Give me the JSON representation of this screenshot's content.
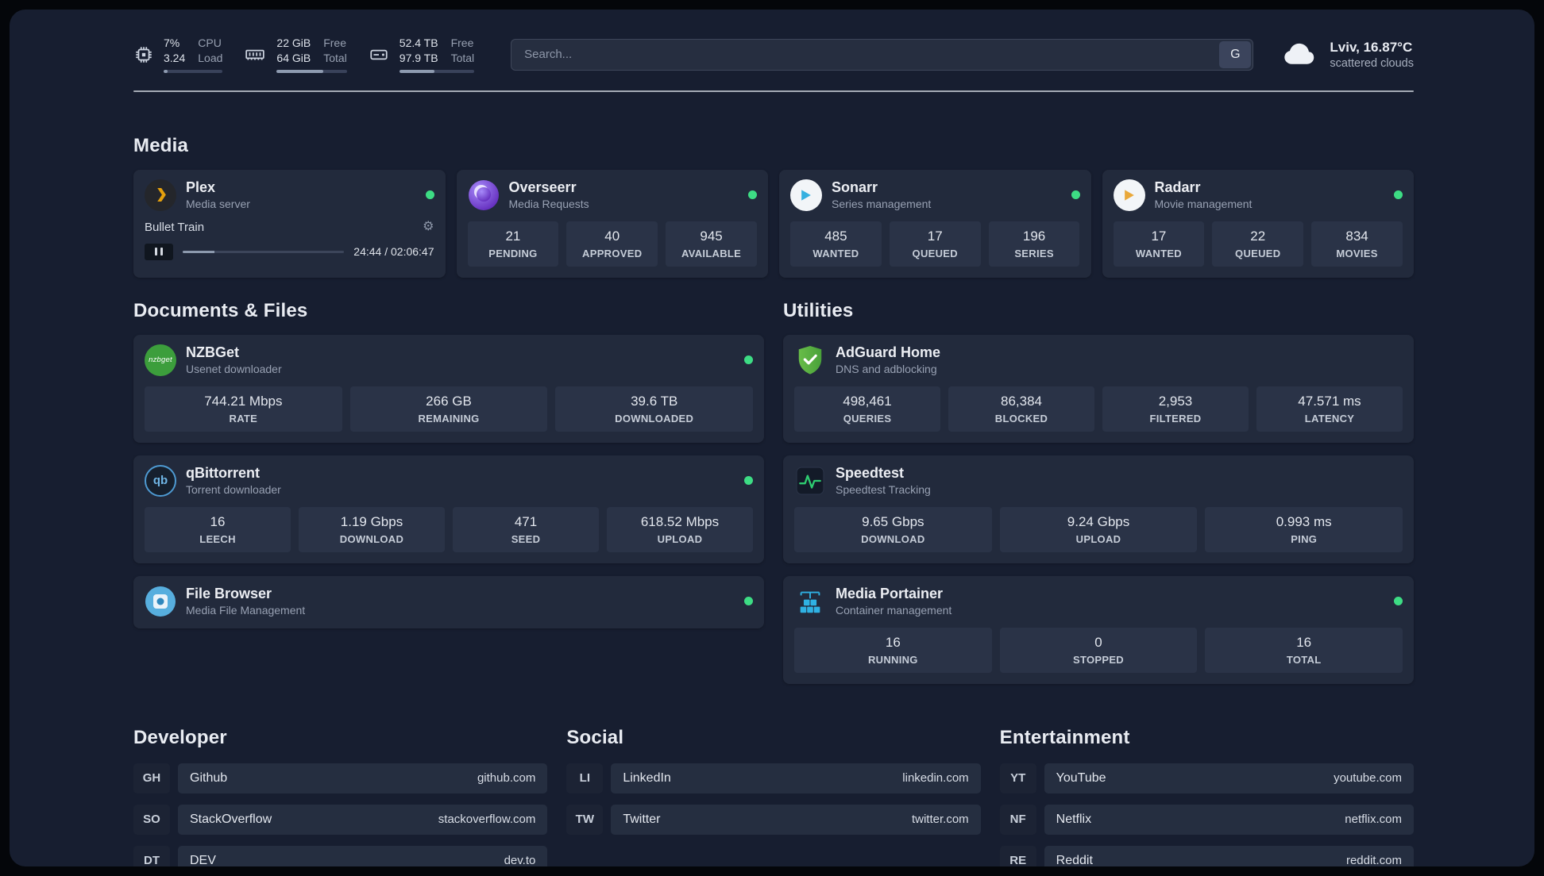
{
  "topbar": {
    "cpu": {
      "percent": "7%",
      "value": "3.24",
      "label1": "CPU",
      "label2": "Load",
      "bar_percent": 7
    },
    "memory": {
      "free": "22 GiB",
      "total": "64 GiB",
      "label1": "Free",
      "label2": "Total",
      "bar_percent": 66
    },
    "disk": {
      "free": "52.4 TB",
      "total": "97.9 TB",
      "label1": "Free",
      "label2": "Total",
      "bar_percent": 47
    },
    "search": {
      "placeholder": "Search...",
      "engine": "G"
    },
    "weather": {
      "location": "Lviv, 16.87°C",
      "condition": "scattered clouds"
    }
  },
  "media": {
    "title": "Media",
    "plex": {
      "name": "Plex",
      "desc": "Media server",
      "now_playing": "Bullet Train",
      "time": "24:44 / 02:06:47",
      "progress_percent": 19.5
    },
    "overseerr": {
      "name": "Overseerr",
      "desc": "Media Requests",
      "stats": [
        {
          "value": "21",
          "label": "PENDING"
        },
        {
          "value": "40",
          "label": "APPROVED"
        },
        {
          "value": "945",
          "label": "AVAILABLE"
        }
      ]
    },
    "sonarr": {
      "name": "Sonarr",
      "desc": "Series management",
      "stats": [
        {
          "value": "485",
          "label": "WANTED"
        },
        {
          "value": "17",
          "label": "QUEUED"
        },
        {
          "value": "196",
          "label": "SERIES"
        }
      ]
    },
    "radarr": {
      "name": "Radarr",
      "desc": "Movie management",
      "stats": [
        {
          "value": "17",
          "label": "WANTED"
        },
        {
          "value": "22",
          "label": "QUEUED"
        },
        {
          "value": "834",
          "label": "MOVIES"
        }
      ]
    }
  },
  "documents": {
    "title": "Documents & Files",
    "nzbget": {
      "name": "NZBGet",
      "desc": "Usenet downloader",
      "icon_text": "nzbget",
      "stats": [
        {
          "value": "744.21 Mbps",
          "label": "RATE"
        },
        {
          "value": "266 GB",
          "label": "REMAINING"
        },
        {
          "value": "39.6 TB",
          "label": "DOWNLOADED"
        }
      ]
    },
    "qbittorrent": {
      "name": "qBittorrent",
      "desc": "Torrent downloader",
      "icon_text": "qb",
      "stats": [
        {
          "value": "16",
          "label": "LEECH"
        },
        {
          "value": "1.19 Gbps",
          "label": "DOWNLOAD"
        },
        {
          "value": "471",
          "label": "SEED"
        },
        {
          "value": "618.52 Mbps",
          "label": "UPLOAD"
        }
      ]
    },
    "filebrowser": {
      "name": "File Browser",
      "desc": "Media File Management"
    }
  },
  "utilities": {
    "title": "Utilities",
    "adguard": {
      "name": "AdGuard Home",
      "desc": "DNS and adblocking",
      "stats": [
        {
          "value": "498,461",
          "label": "QUERIES"
        },
        {
          "value": "86,384",
          "label": "BLOCKED"
        },
        {
          "value": "2,953",
          "label": "FILTERED"
        },
        {
          "value": "47.571 ms",
          "label": "LATENCY"
        }
      ]
    },
    "speedtest": {
      "name": "Speedtest",
      "desc": "Speedtest Tracking",
      "stats": [
        {
          "value": "9.65 Gbps",
          "label": "DOWNLOAD"
        },
        {
          "value": "9.24 Gbps",
          "label": "UPLOAD"
        },
        {
          "value": "0.993 ms",
          "label": "PING"
        }
      ]
    },
    "portainer": {
      "name": "Media Portainer",
      "desc": "Container management",
      "stats": [
        {
          "value": "16",
          "label": "RUNNING"
        },
        {
          "value": "0",
          "label": "STOPPED"
        },
        {
          "value": "16",
          "label": "TOTAL"
        }
      ]
    }
  },
  "bookmarks": {
    "developer": {
      "title": "Developer",
      "items": [
        {
          "abbr": "GH",
          "name": "Github",
          "url": "github.com"
        },
        {
          "abbr": "SO",
          "name": "StackOverflow",
          "url": "stackoverflow.com"
        },
        {
          "abbr": "DT",
          "name": "DEV",
          "url": "dev.to"
        }
      ]
    },
    "social": {
      "title": "Social",
      "items": [
        {
          "abbr": "LI",
          "name": "LinkedIn",
          "url": "linkedin.com"
        },
        {
          "abbr": "TW",
          "name": "Twitter",
          "url": "twitter.com"
        }
      ]
    },
    "entertainment": {
      "title": "Entertainment",
      "items": [
        {
          "abbr": "YT",
          "name": "YouTube",
          "url": "youtube.com"
        },
        {
          "abbr": "NF",
          "name": "Netflix",
          "url": "netflix.com"
        },
        {
          "abbr": "RE",
          "name": "Reddit",
          "url": "reddit.com"
        }
      ]
    }
  },
  "colors": {
    "status_green": "#3ddc84",
    "plex_gold": "#e5a00d",
    "sonarr_blue": "#35b0e0",
    "radarr_amber": "#e9a83a",
    "overseerr_purple": "#7c3aed",
    "nzbget_green": "#3c9e3c",
    "qbittorrent_blue": "#4e9ad2",
    "adguard_green": "#5fb549",
    "speedtest_green": "#2ecc71",
    "portainer_blue": "#2fb1e3",
    "background": "#171e30",
    "card": "#222a3c",
    "stat_tile": "#2a3347"
  }
}
